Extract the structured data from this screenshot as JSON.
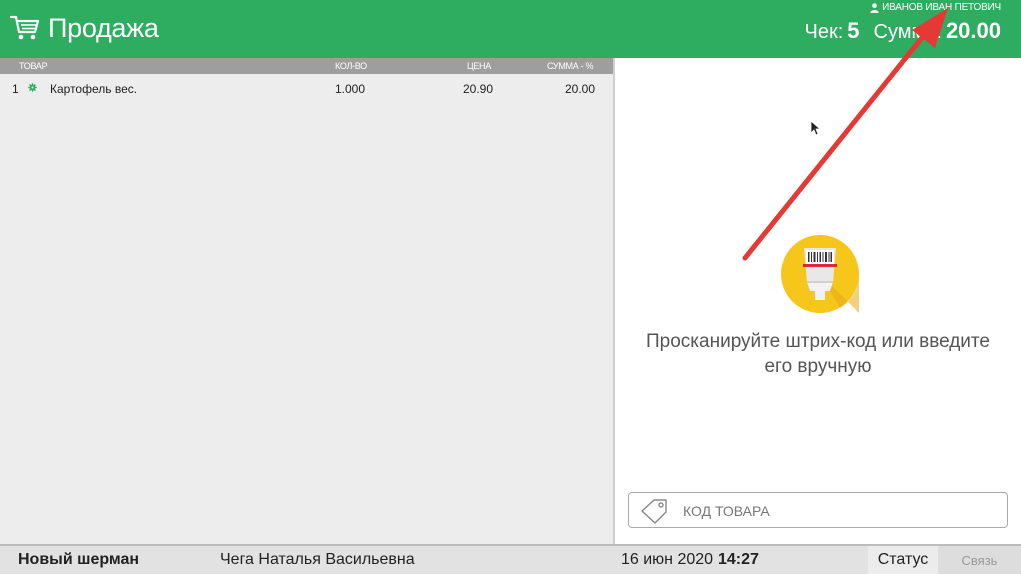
{
  "header": {
    "title": "Продажа",
    "user": "ИВАНОВ ИВАН ПЕТОВИЧ",
    "check_label": "Чек:",
    "check_value": "5",
    "sum_label": "Сумма:",
    "sum_value": "20.00",
    "icon": "cart-icon",
    "user_icon": "user-icon",
    "color": "#2eac5f"
  },
  "table": {
    "columns": [
      "ТОВАР",
      "КОЛ-ВО",
      "ЦЕНА",
      "СУММА - %"
    ],
    "rows": [
      {
        "index": "1",
        "name": "Картофель вес.",
        "qty": "1.000",
        "price": "20.90",
        "sum": "20.00",
        "status_icon": "gear-icon"
      }
    ]
  },
  "scan": {
    "hint_line1": "Просканируйте штрих-код или введите",
    "hint_line2": "его вручную",
    "icon": "barcode-scanner-icon",
    "code_placeholder": "КОД ТОВАРА",
    "code_value": "",
    "code_icon": "tag-icon"
  },
  "footer": {
    "store": "Новый шерман",
    "cashier": "Чега Наталья Васильевна",
    "date": "16 июн 2020",
    "time": "14:27",
    "status": "Статус",
    "link": "Связь"
  }
}
